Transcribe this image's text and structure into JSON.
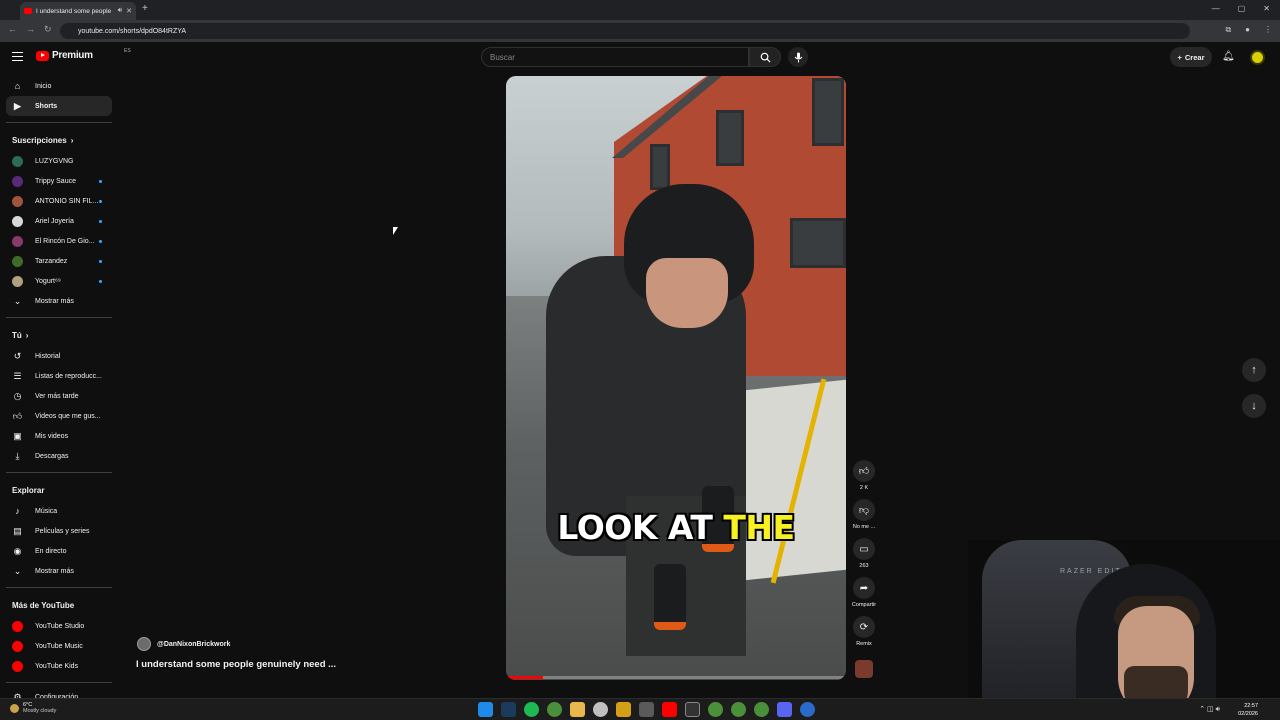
{
  "browser": {
    "tab_title": "I understand some people",
    "url": "youtube.com/shorts/dpdO84tRZYA"
  },
  "masthead": {
    "logo": "Premium",
    "logo_country": "ES",
    "search_placeholder": "Buscar",
    "create_label": "Crear"
  },
  "sidebar": {
    "main": [
      {
        "label": "Inicio",
        "icon": "home-icon"
      },
      {
        "label": "Shorts",
        "icon": "shorts-icon"
      }
    ],
    "subscriptions_title": "Suscripciones",
    "subscriptions": [
      {
        "label": "LUZYGVNG",
        "color": "#2e6b53",
        "dot": false
      },
      {
        "label": "Trippy Sauce",
        "color": "#5a2a7a",
        "dot": true
      },
      {
        "label": "ANTONIO SIN FIL...",
        "color": "#a0543a",
        "dot": true
      },
      {
        "label": "Ariel Joyería",
        "color": "#d8d8d8",
        "dot": true
      },
      {
        "label": "El Rincón De Gio...",
        "color": "#8a3a6a",
        "dot": true
      },
      {
        "label": "Tarzandez",
        "color": "#3f6b2a",
        "dot": true
      },
      {
        "label": "Yogurt⁶⁹",
        "color": "#b0a080",
        "dot": true
      }
    ],
    "show_more": "Mostrar más",
    "you_title": "Tú",
    "you": [
      {
        "label": "Historial",
        "icon": "history-icon"
      },
      {
        "label": "Listas de reproducc...",
        "icon": "playlist-icon"
      },
      {
        "label": "Ver más tarde",
        "icon": "clock-icon"
      },
      {
        "label": "Videos que me gus...",
        "icon": "like-icon"
      },
      {
        "label": "Mis videos",
        "icon": "video-icon"
      },
      {
        "label": "Descargas",
        "icon": "download-icon"
      }
    ],
    "explore_title": "Explorar",
    "explore": [
      {
        "label": "Música",
        "icon": "music-icon"
      },
      {
        "label": "Películas y series",
        "icon": "film-icon"
      },
      {
        "label": "En directo",
        "icon": "live-icon"
      },
      {
        "label": "Mostrar más",
        "icon": "chevron-down-icon"
      }
    ],
    "more_title": "Más de YouTube",
    "more": [
      {
        "label": "YouTube Studio"
      },
      {
        "label": "YouTube Music"
      },
      {
        "label": "YouTube Kids"
      }
    ],
    "settings": "Configuración"
  },
  "short": {
    "caption_white": "LOOK AT",
    "caption_yellow": "THE",
    "channel": "@DanNixonBrickwork",
    "title": "I understand some people genuinely need ...",
    "progress": 0.11
  },
  "actions": {
    "likes": "2 K",
    "dislike": "No me ...",
    "comments": "263",
    "share": "Compartir",
    "remix": "Remix"
  },
  "webcam": {
    "chair_brand": "RAZER EDITION"
  },
  "taskbar": {
    "temp": "6°C",
    "weather": "Mostly cloudy",
    "time": "22:57",
    "date": "02/2026"
  }
}
